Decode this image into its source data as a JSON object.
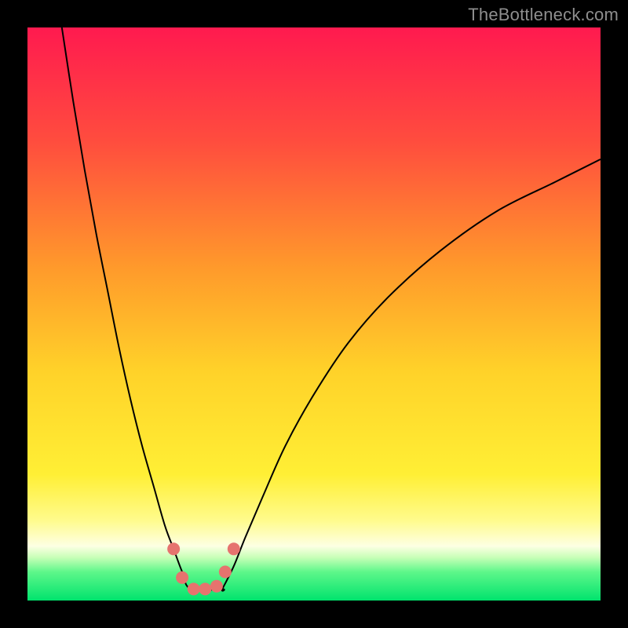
{
  "watermark": "TheBottleneck.com",
  "chart_data": {
    "type": "line",
    "title": "",
    "xlabel": "",
    "ylabel": "",
    "xlim": [
      0,
      100
    ],
    "ylim": [
      0,
      100
    ],
    "grid": false,
    "legend": false,
    "background_gradient": {
      "stops": [
        {
          "pos": 0.0,
          "color": "#ff1a4f"
        },
        {
          "pos": 0.2,
          "color": "#ff4d3e"
        },
        {
          "pos": 0.42,
          "color": "#ff9a2b"
        },
        {
          "pos": 0.6,
          "color": "#ffd229"
        },
        {
          "pos": 0.78,
          "color": "#ffef35"
        },
        {
          "pos": 0.86,
          "color": "#fffb8c"
        },
        {
          "pos": 0.905,
          "color": "#fdffe3"
        },
        {
          "pos": 0.925,
          "color": "#c7ffb7"
        },
        {
          "pos": 0.95,
          "color": "#5ef78a"
        },
        {
          "pos": 1.0,
          "color": "#00e36d"
        }
      ]
    },
    "series": [
      {
        "name": "left-branch",
        "x": [
          6,
          8,
          10,
          12,
          14,
          16,
          18,
          20,
          22,
          24,
          25.5,
          27,
          28.5
        ],
        "y": [
          100,
          87,
          75,
          64,
          54,
          44,
          35,
          27,
          20,
          13,
          9,
          5,
          2
        ]
      },
      {
        "name": "right-branch",
        "x": [
          34,
          36,
          38,
          41,
          45,
          50,
          56,
          63,
          72,
          82,
          92,
          100
        ],
        "y": [
          2,
          6,
          11,
          18,
          27,
          36,
          45,
          53,
          61,
          68,
          73,
          77
        ]
      }
    ],
    "floor_segment": {
      "x": [
        28.5,
        34
      ],
      "y": [
        2,
        2
      ]
    },
    "markers": [
      {
        "x": 25.5,
        "y": 9
      },
      {
        "x": 27.0,
        "y": 4
      },
      {
        "x": 29.0,
        "y": 2
      },
      {
        "x": 31.0,
        "y": 2
      },
      {
        "x": 33.0,
        "y": 2.5
      },
      {
        "x": 34.5,
        "y": 5
      },
      {
        "x": 36.0,
        "y": 9
      }
    ],
    "marker_style": {
      "color": "#e6736e",
      "radius_px": 8
    }
  }
}
